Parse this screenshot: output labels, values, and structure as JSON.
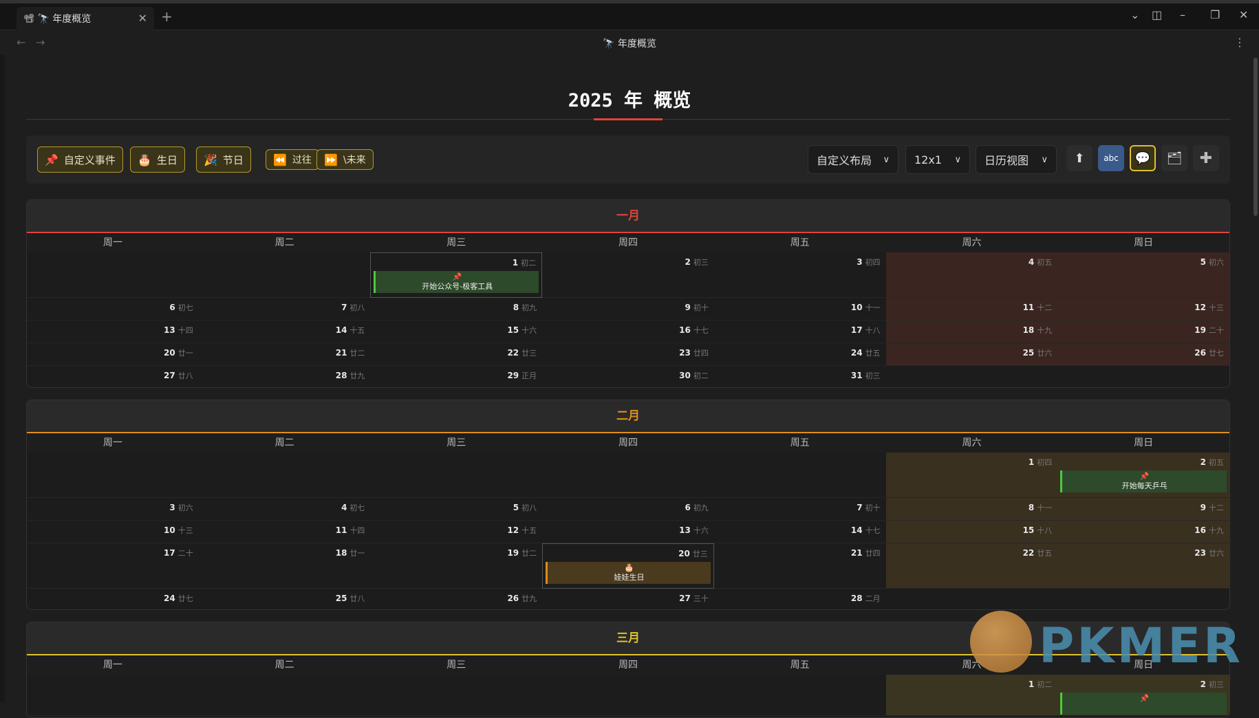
{
  "window": {
    "tab_label": "🔭 年度概览",
    "tab_icon": "📽",
    "nav_title": "🔭 年度概览"
  },
  "page": {
    "title": "2025 年 概览"
  },
  "toolbar": {
    "custom_event": "自定义事件",
    "custom_event_icon": "📌",
    "birthday": "生日",
    "birthday_icon": "🎂",
    "holiday": "节日",
    "holiday_icon": "🎉",
    "past": "过往",
    "past_icon": "⏪",
    "future": "\\未来",
    "future_icon": "⏩",
    "layout_select": "自定义布局",
    "grid_select": "12x1",
    "view_select": "日历视图",
    "icons": [
      "up-arrow-icon",
      "abc-icon",
      "speech-bubble-icon",
      "folder-icon",
      "plus-icon"
    ]
  },
  "weekdays": [
    "周一",
    "周二",
    "周三",
    "周四",
    "周五",
    "周六",
    "周日"
  ],
  "months": [
    {
      "name": "一月",
      "color": "#e0443a",
      "weekend_class": "wkend-red",
      "offset": 2,
      "days": [
        [
          "1",
          "初二"
        ],
        [
          "2",
          "初三"
        ],
        [
          "3",
          "初四"
        ],
        [
          "4",
          "初五"
        ],
        [
          "5",
          "初六"
        ],
        [
          "6",
          "初七"
        ],
        [
          "7",
          "初八"
        ],
        [
          "8",
          "初九"
        ],
        [
          "9",
          "初十"
        ],
        [
          "10",
          "十一"
        ],
        [
          "11",
          "十二"
        ],
        [
          "12",
          "十三"
        ],
        [
          "13",
          "十四"
        ],
        [
          "14",
          "十五"
        ],
        [
          "15",
          "十六"
        ],
        [
          "16",
          "十七"
        ],
        [
          "17",
          "十八"
        ],
        [
          "18",
          "十九"
        ],
        [
          "19",
          "二十"
        ],
        [
          "20",
          "廿一"
        ],
        [
          "21",
          "廿二"
        ],
        [
          "22",
          "廿三"
        ],
        [
          "23",
          "廿四"
        ],
        [
          "24",
          "廿五"
        ],
        [
          "25",
          "廿六"
        ],
        [
          "26",
          "廿七"
        ],
        [
          "27",
          "廿八"
        ],
        [
          "28",
          "廿九"
        ],
        [
          "29",
          "正月"
        ],
        [
          "30",
          "初二"
        ],
        [
          "31",
          "初三"
        ]
      ],
      "events": [
        {
          "day": 1,
          "icon": "📌",
          "text": "开始公众号-极客工具",
          "style": "green"
        }
      ]
    },
    {
      "name": "二月",
      "color": "#e0901c",
      "weekend_class": "wkend-olive",
      "offset": 5,
      "days": [
        [
          "1",
          "初四"
        ],
        [
          "2",
          "初五"
        ],
        [
          "3",
          "初六"
        ],
        [
          "4",
          "初七"
        ],
        [
          "5",
          "初八"
        ],
        [
          "6",
          "初九"
        ],
        [
          "7",
          "初十"
        ],
        [
          "8",
          "十一"
        ],
        [
          "9",
          "十二"
        ],
        [
          "10",
          "十三"
        ],
        [
          "11",
          "十四"
        ],
        [
          "12",
          "十五"
        ],
        [
          "13",
          "十六"
        ],
        [
          "14",
          "十七"
        ],
        [
          "15",
          "十八"
        ],
        [
          "16",
          "十九"
        ],
        [
          "17",
          "二十"
        ],
        [
          "18",
          "廿一"
        ],
        [
          "19",
          "廿二"
        ],
        [
          "20",
          "廿三"
        ],
        [
          "21",
          "廿四"
        ],
        [
          "22",
          "廿五"
        ],
        [
          "23",
          "廿六"
        ],
        [
          "24",
          "廿七"
        ],
        [
          "25",
          "廿八"
        ],
        [
          "26",
          "廿九"
        ],
        [
          "27",
          "三十"
        ],
        [
          "28",
          "二月"
        ]
      ],
      "events": [
        {
          "day": 2,
          "icon": "📌",
          "text": "开始每天乒乓",
          "style": "green"
        },
        {
          "day": 20,
          "icon": "🎂",
          "text": "娃娃生日",
          "style": "orange"
        }
      ]
    },
    {
      "name": "三月",
      "color": "#e0c22c",
      "weekend_class": "wkend-olive2",
      "offset": 5,
      "days": [
        [
          "1",
          "初二"
        ],
        [
          "2",
          "初三"
        ]
      ],
      "events": [
        {
          "day": 2,
          "icon": "📌",
          "text": "",
          "style": "green"
        }
      ]
    }
  ],
  "watermark": {
    "text": "PKMER"
  }
}
